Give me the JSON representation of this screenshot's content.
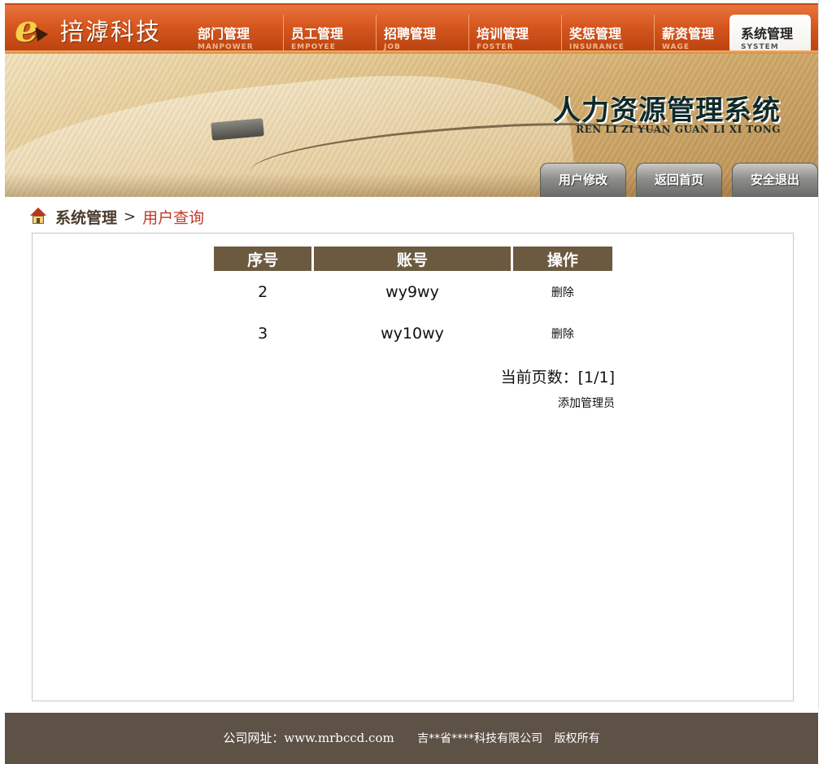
{
  "brand": {
    "logo_letter": "e",
    "company_name": "掊滹科技"
  },
  "nav": {
    "items": [
      {
        "label": "部门管理",
        "sub": "MANPOWER"
      },
      {
        "label": "员工管理",
        "sub": "EMPOYEE"
      },
      {
        "label": "招聘管理",
        "sub": "JOB"
      },
      {
        "label": "培训管理",
        "sub": "FOSTER"
      },
      {
        "label": "奖惩管理",
        "sub": "INSURANCE"
      },
      {
        "label": "薪资管理",
        "sub": "WAGE"
      }
    ],
    "active": {
      "label": "系统管理",
      "sub": "SYSTEM"
    }
  },
  "banner": {
    "title": "人力资源管理系统",
    "subtitle": "REN LI ZI YUAN GUAN LI XI TONG",
    "buttons": [
      "用户修改",
      "返回首页",
      "安全退出"
    ]
  },
  "breadcrumb": {
    "root": "系统管理",
    "separator": ">",
    "current": "用户查询"
  },
  "table": {
    "headers": [
      "序号",
      "账号",
      "操作"
    ],
    "rows": [
      {
        "id": "2",
        "account": "wy9wy",
        "action": "删除"
      },
      {
        "id": "3",
        "account": "wy10wy",
        "action": "删除"
      }
    ]
  },
  "pager": {
    "text": "当前页数：[1/1]"
  },
  "add_admin_label": "添加管理员",
  "footer": {
    "url_text": "公司网址：www.mrbccd.com",
    "company": "吉**省****科技有限公司",
    "rights": "版权所有"
  },
  "colors": {
    "nav_orange": "#d5561e",
    "table_header": "#6b5a40",
    "breadcrumb_current": "#c0392b",
    "footer_bg": "#5e5247"
  }
}
